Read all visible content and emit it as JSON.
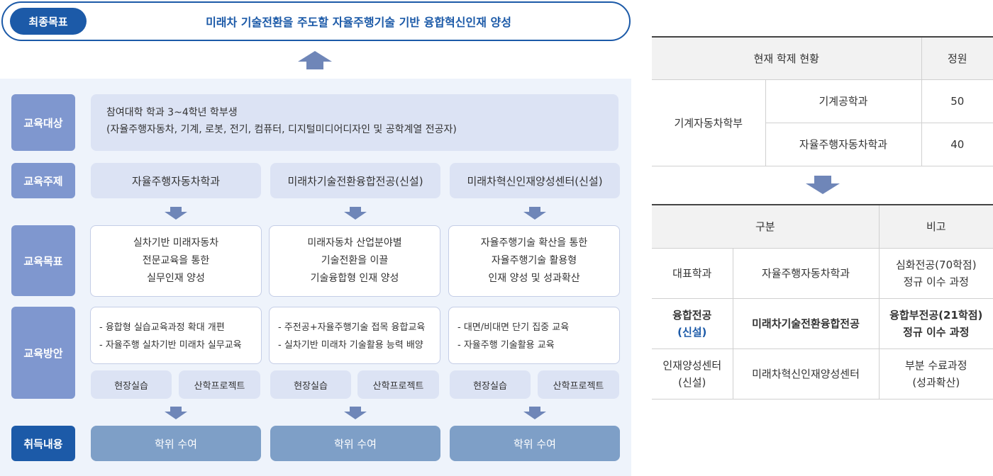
{
  "goal": {
    "label": "최종목표",
    "text": "미래차 기술전환을 주도할 자율주행기술 기반 융합혁신인재 양성"
  },
  "rows": {
    "target_label": "교육대상",
    "topic_label": "교육주제",
    "objective_label": "교육목표",
    "method_label": "교육방안",
    "result_label": "취득내용"
  },
  "target": {
    "line1": "참여대학 학과 3~4학년 학부생",
    "line2": "(자율주행자동차, 기계, 로봇,  전기, 컴퓨터, 디지털미디어디자인 및 공학계열 전공자)"
  },
  "columns": [
    {
      "topic": "자율주행자동차학과",
      "objective": [
        "실차기반 미래자동차",
        "전문교육을 통한",
        "실무인재 양성"
      ],
      "methods": [
        "- 융합형 실습교육과정 확대 개편",
        "- 자율주행 실차기반 미래차 실무교육"
      ],
      "practice": "현장실습",
      "project": "산학프로젝트",
      "result": "학위 수여"
    },
    {
      "topic": "미래차기술전환융합전공(신설)",
      "objective": [
        "미래자동차 산업분야별",
        "기술전환을 이끌",
        "기술융합형 인재 양성"
      ],
      "methods": [
        "- 주전공+자율주행기술 접목 융합교육",
        "- 실차기반 미래차 기술활용 능력 배양"
      ],
      "practice": "현장실습",
      "project": "산학프로젝트",
      "result": "학위 수여"
    },
    {
      "topic": "미래차혁신인재양성센터(신설)",
      "objective": [
        "자율주행기술 확산을 통한",
        "자율주행기술 활용형",
        "인재 양성 및 성과확산"
      ],
      "methods": [
        "- 대면/비대면 단기 집중 교육",
        "- 자율주행 기술활용 교육"
      ],
      "practice": "현장실습",
      "project": "산학프로젝트",
      "result": "학위 수여"
    }
  ],
  "table1": {
    "header_status": "현재 학제 현황",
    "header_quota": "정원",
    "school": "기계자동차학부",
    "rows": [
      {
        "dept": "기계공학과",
        "quota": "50"
      },
      {
        "dept": "자율주행자동차학과",
        "quota": "40"
      }
    ]
  },
  "table2": {
    "header_category": "구분",
    "header_note": "비고",
    "rows": [
      {
        "type": [
          "대표학과"
        ],
        "name": "자율주행자동차학과",
        "note": [
          "심화전공(70학점)",
          "정규 이수 과정"
        ]
      },
      {
        "type": [
          "융합전공",
          "(신설)"
        ],
        "name": "미래차기술전환융합전공",
        "note": [
          "융합부전공(21학점)",
          "정규 이수 과정"
        ]
      },
      {
        "type": [
          "인재양성센터",
          "(신설)"
        ],
        "name": "미래차혁신인재양성센터",
        "note": [
          "부분 수료과정",
          "(성과확산)"
        ]
      }
    ]
  },
  "colors": {
    "primary": "#1c5aa8",
    "row_label": "#7f97cf",
    "arrow": "#6f86b8",
    "lavender": "#dce3f4",
    "panel": "#eef3fb",
    "result_box": "#7e9fc7"
  }
}
